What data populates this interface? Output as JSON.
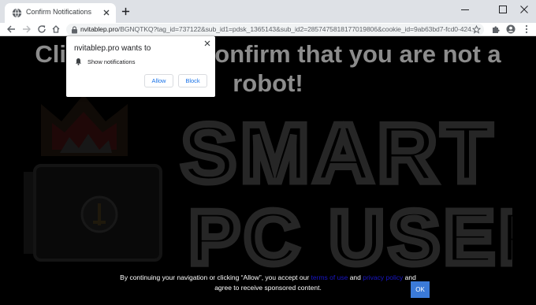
{
  "browser": {
    "tab_title": "Confirm Notifications",
    "url_host": "nvitablep.pro",
    "url_path": "/BGNQTKQ?tag_id=737122&sub_id1=pdsk_1365143&sub_id2=2857475818177019806&cookie_id=9ab63bd7-fcd0-424..."
  },
  "page": {
    "headline": "Click Allow to confirm that you are not a robot!",
    "watermark_line1": "SMART",
    "watermark_line2": "PC USER"
  },
  "permission_popup": {
    "title": "nvitablep.pro wants to",
    "row_label": "Show notifications",
    "allow_label": "Allow",
    "block_label": "Block"
  },
  "consent": {
    "part1": "By continuing your navigation or clicking “Allow”, you accept our ",
    "terms_link": "terms of use",
    "and1": " and ",
    "privacy_link": "privacy policy",
    "and2": " and",
    "line2": "agree to receive sponsored content.",
    "ok_label": "OK"
  },
  "colors": {
    "headline": "#8c8c8c",
    "link": "#1a16c8",
    "ok_button": "#3b7ad8",
    "popup_button_text": "#1a73e8"
  }
}
